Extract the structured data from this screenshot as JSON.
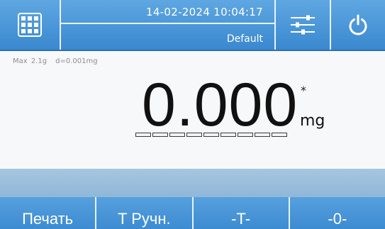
{
  "header": {
    "datetime": "14-02-2024 10:04:17",
    "profile": "Default"
  },
  "scale": {
    "max_capacity": "Max 2.1g",
    "readability": "d=0.001mg"
  },
  "display": {
    "weight": "0.000",
    "stability_mark": "*",
    "unit": "mg",
    "bargraph_segments": 9
  },
  "function_keys": {
    "print": "Печать",
    "manual_tare": "T Ручн.",
    "tare": "-T-",
    "zero": "-0-"
  },
  "colors": {
    "header_blue": "#4a96d8",
    "message_strip": "#9fc1dd",
    "button_blue": "#4a95d8",
    "text_gray": "#8a8e94"
  },
  "icons": {
    "menu": "grid-menu-icon",
    "settings": "sliders-icon",
    "power": "power-icon"
  }
}
